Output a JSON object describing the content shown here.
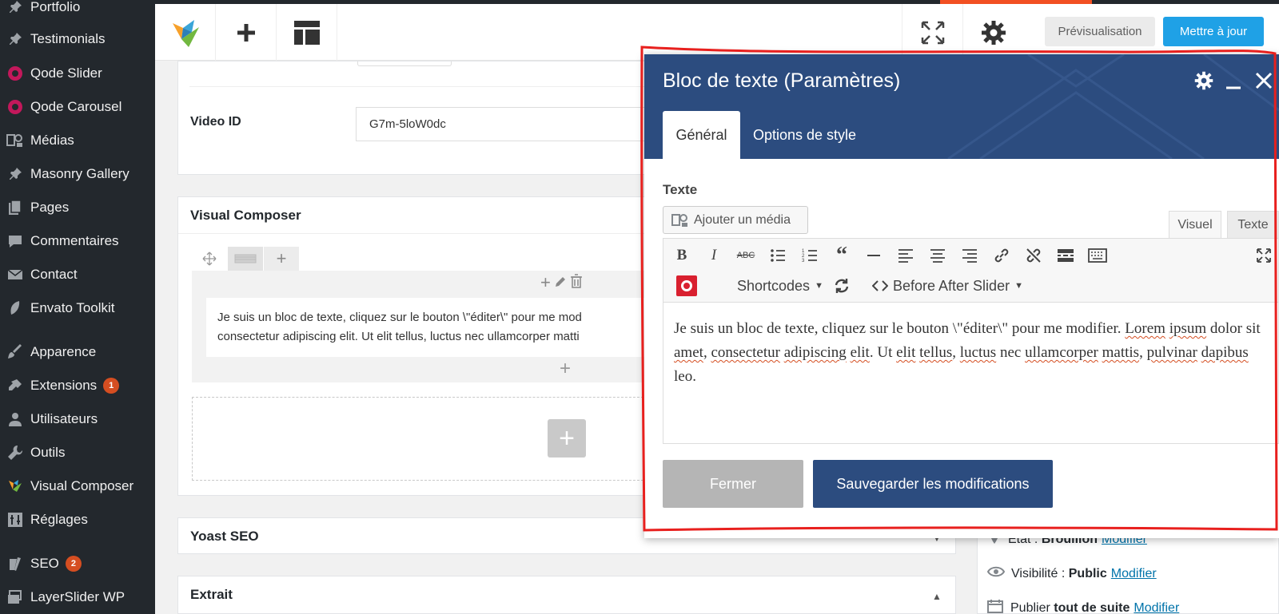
{
  "sidebar": {
    "items": [
      {
        "label": "Portfolio",
        "icon": "pin-icon"
      },
      {
        "label": "Testimonials",
        "icon": "pin-icon"
      },
      {
        "label": "Qode Slider",
        "icon": "qode-icon"
      },
      {
        "label": "Qode Carousel",
        "icon": "qode-icon"
      },
      {
        "label": "Médias",
        "icon": "media-icon"
      },
      {
        "label": "Masonry Gallery",
        "icon": "pin-icon"
      },
      {
        "label": "Pages",
        "icon": "pages-icon"
      },
      {
        "label": "Commentaires",
        "icon": "comment-icon"
      },
      {
        "label": "Contact",
        "icon": "mail-icon"
      },
      {
        "label": "Envato Toolkit",
        "icon": "leaf-icon"
      },
      {
        "label": "Apparence",
        "icon": "brush-icon"
      },
      {
        "label": "Extensions",
        "icon": "plugin-icon",
        "badge": "1"
      },
      {
        "label": "Utilisateurs",
        "icon": "user-icon"
      },
      {
        "label": "Outils",
        "icon": "wrench-icon"
      },
      {
        "label": "Visual Composer",
        "icon": "vc-icon"
      },
      {
        "label": "Réglages",
        "icon": "settings-icon"
      },
      {
        "label": "SEO",
        "icon": "yoast-icon",
        "badge": "2"
      },
      {
        "label": "LayerSlider WP",
        "icon": "layers-icon"
      }
    ]
  },
  "topbar": {
    "preview_label": "Prévisualisation",
    "update_label": "Mettre à jour"
  },
  "main": {
    "video_id_label": "Video ID",
    "video_id_value": "G7m-5loW0dc",
    "vc_title": "Visual Composer",
    "vc_text_line1": "Je suis un bloc de texte, cliquez sur le bouton \\\"éditer\\\" pour me mod",
    "vc_text_line2": "consectetur adipiscing elit. Ut elit tellus, luctus nec ullamcorper matti",
    "yoast_title": "Yoast SEO",
    "extrait_title": "Extrait"
  },
  "meta": {
    "etat_label": "État :",
    "etat_value": "Brouillon",
    "etat_link": "Modifier",
    "visibilite_label": "Visibilité :",
    "visibilite_value": "Public",
    "visibilite_link": "Modifier",
    "publier_label": "Publier",
    "publier_value": "tout de suite",
    "publier_link": "Modifier"
  },
  "modal": {
    "title": "Bloc de texte (Paramètres)",
    "tabs": [
      {
        "label": "Général"
      },
      {
        "label": "Options de style"
      }
    ],
    "texte_label": "Texte",
    "add_media_label": "Ajouter un média",
    "editor_tabs": [
      {
        "label": "Visuel"
      },
      {
        "label": "Texte"
      }
    ],
    "shortcodes_label": "Shortcodes",
    "before_after_label": "Before After Slider",
    "body_parts": [
      "Je suis un bloc de texte, cliquez sur le bouton \\\"éditer\\\" pour me modifier. ",
      "Lorem",
      " ",
      "ipsum",
      " dolor sit ",
      "amet",
      ", ",
      "consectetur",
      " ",
      "adipiscing",
      " ",
      "elit",
      ". Ut ",
      "elit",
      " ",
      "tellus",
      ", ",
      "luctus",
      " nec ",
      "ullamcorper",
      " ",
      "mattis",
      ", ",
      "pulvinar",
      " ",
      "dapibus",
      " leo."
    ],
    "close_label": "Fermer",
    "save_label": "Sauvegarder les modifications"
  },
  "colors": {
    "sidebar_bg": "#23282d",
    "modal_header": "#2c4c7f",
    "update_button": "#1fa1e6",
    "badge": "#d54e21",
    "annotation": "#e8201e"
  }
}
